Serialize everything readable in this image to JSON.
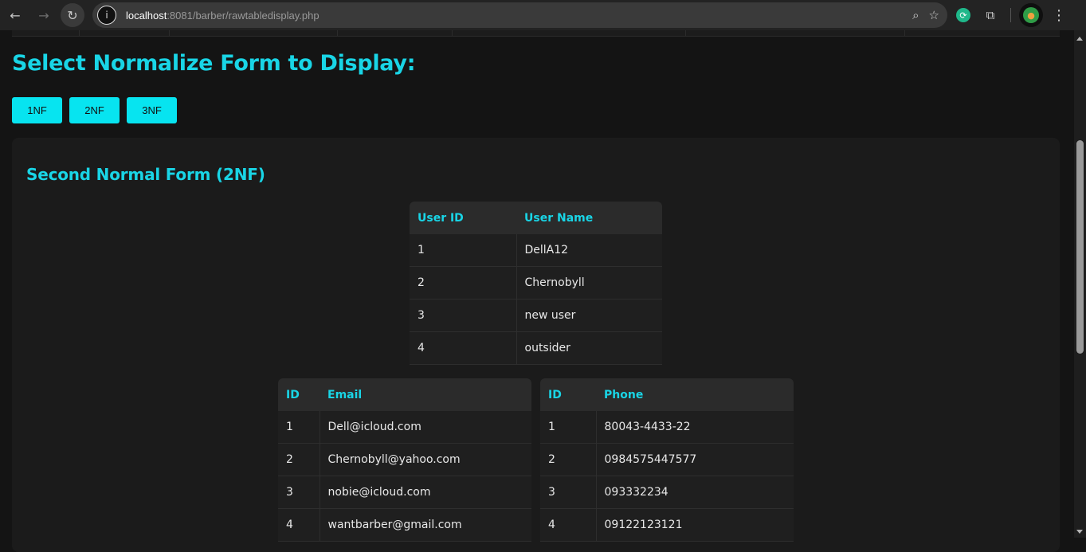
{
  "browser": {
    "url_host": "localhost",
    "url_rest": ":8081/barber/rawtabledisplay.php",
    "icons": {
      "back": "←",
      "forward": "→",
      "reload": "↻",
      "info": "i",
      "zoom": "⌕",
      "bookmark": "☆",
      "extension": "⟳",
      "puzzle": "⧉",
      "menu": "⋮"
    }
  },
  "page": {
    "heading": "Select Normalize Form to Display:",
    "buttons": [
      "1NF",
      "2NF",
      "3NF"
    ],
    "panel_title": "Second Normal Form (2NF)",
    "accent_color": "#19d5e6",
    "button_color": "#07e4f0"
  },
  "users_table": {
    "headers": [
      "User ID",
      "User Name"
    ],
    "rows": [
      [
        "1",
        "DellA12"
      ],
      [
        "2",
        "Chernobyll"
      ],
      [
        "3",
        "new user"
      ],
      [
        "4",
        "outsider"
      ]
    ]
  },
  "email_table": {
    "headers": [
      "ID",
      "Email"
    ],
    "rows": [
      [
        "1",
        "Dell@icloud.com"
      ],
      [
        "2",
        "Chernobyll@yahoo.com"
      ],
      [
        "3",
        "nobie@icloud.com"
      ],
      [
        "4",
        "wantbarber@gmail.com"
      ]
    ]
  },
  "phone_table": {
    "headers": [
      "ID",
      "Phone"
    ],
    "rows": [
      [
        "1",
        "80043-4433-22"
      ],
      [
        "2",
        "0984575447577"
      ],
      [
        "3",
        "093332234"
      ],
      [
        "4",
        "09122123121"
      ]
    ]
  }
}
